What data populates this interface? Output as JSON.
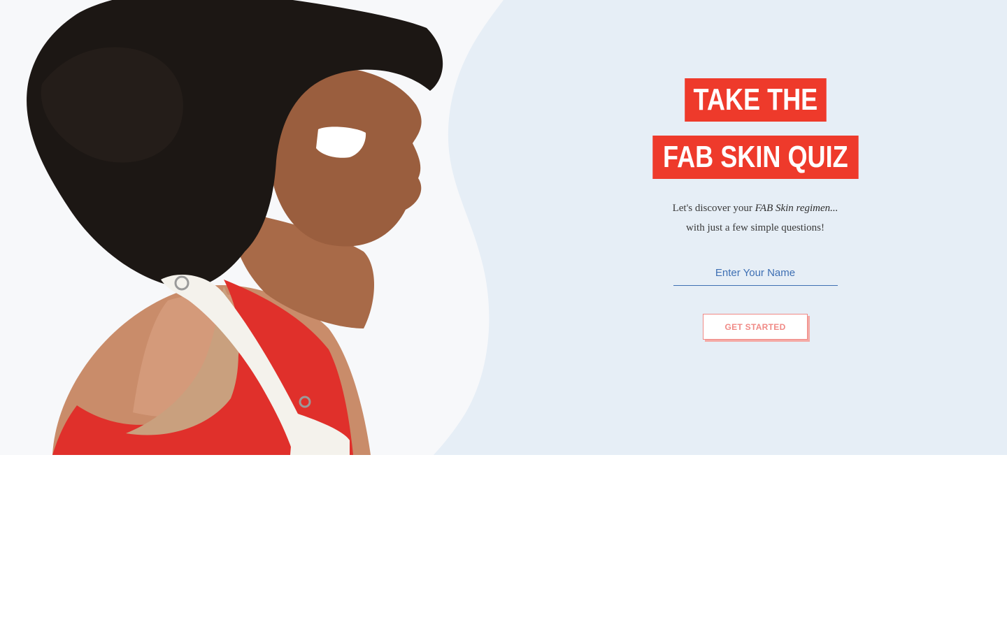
{
  "quiz": {
    "title_line_1": "TAKE THE",
    "title_line_2": "FAB SKIN QUIZ",
    "intro_prefix": "Let's discover your ",
    "intro_emphasis": "FAB Skin regimen...",
    "intro_line_2": "with just a few simple questions!",
    "name_input": {
      "placeholder": "Enter Your Name",
      "value": ""
    },
    "start_button_label": "GET STARTED"
  },
  "colors": {
    "hero_background": "#e6eef6",
    "title_red": "#ee3a2b",
    "input_blue": "#3e6fb3",
    "button_coral": "#f08a86"
  },
  "hero_image": {
    "icon": "hero-photo",
    "alt": ""
  }
}
